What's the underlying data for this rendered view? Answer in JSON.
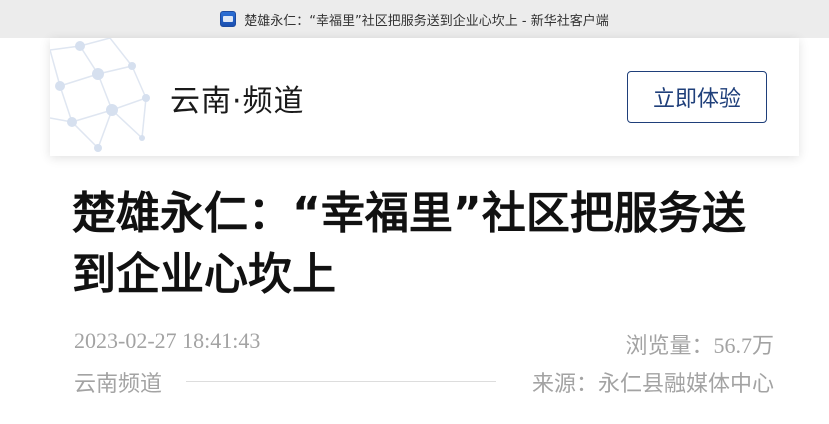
{
  "browser": {
    "page_title": "楚雄永仁：“幸福里”社区把服务送到企业心坎上 - 新华社客户端"
  },
  "channel": {
    "name": "云南·频道",
    "cta_label": "立即体验"
  },
  "article": {
    "title": "楚雄永仁：“幸福里”社区把服务送到企业心坎上",
    "datetime": "2023-02-27 18:41:43",
    "views_label": "浏览量：",
    "views_value": "56.7万",
    "channel_tag": "云南频道",
    "source": "来源：永仁县融媒体中心"
  },
  "colors": {
    "accent": "#1f3f7a",
    "meta_text": "#a3a3a3",
    "top_bar": "#ececec"
  }
}
